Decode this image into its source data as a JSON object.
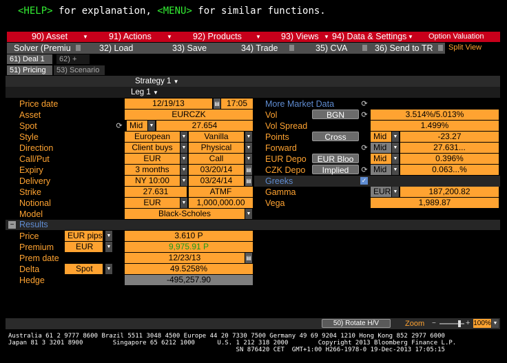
{
  "helpline": {
    "help_key": "<HELP>",
    "help_text": " for explanation, ",
    "menu_key": "<MENU>",
    "menu_text": " for similar functions."
  },
  "menubar": {
    "items": [
      "90) Asset",
      "91) Actions",
      "92) Products",
      "93) Views",
      "94) Data & Settings"
    ],
    "title": "Option Valuation"
  },
  "toolbar": {
    "items": [
      "Solver (Premiu",
      "32) Load",
      "33) Save",
      "34) Trade",
      "35) CVA",
      "36) Send to TR"
    ],
    "split_view": "Split View"
  },
  "tabs": {
    "deal": "61) Deal 1",
    "add": "62) +",
    "pricing": "51) Pricing",
    "scenario": "53) Scenario"
  },
  "header": {
    "strategy": "Strategy 1",
    "leg": "Leg 1"
  },
  "left": {
    "price_date": {
      "label": "Price date",
      "date": "12/19/13",
      "time": "17:05"
    },
    "asset": {
      "label": "Asset",
      "value": "EURCZK"
    },
    "spot": {
      "label": "Spot",
      "side": "Mid",
      "value": "27.654"
    },
    "style": {
      "label": "Style",
      "v1": "European",
      "v2": "Vanilla"
    },
    "direction": {
      "label": "Direction",
      "v1": "Client buys",
      "v2": "Physical"
    },
    "callput": {
      "label": "Call/Put",
      "v1": "EUR",
      "v2": "Call"
    },
    "expiry": {
      "label": "Expiry",
      "v1": "3 months",
      "v2": "03/20/14"
    },
    "delivery": {
      "label": "Delivery",
      "v1": "NY 10:00",
      "v2": "03/24/14"
    },
    "strike": {
      "label": "Strike",
      "v1": "27.631",
      "v2": "ATMF"
    },
    "notional": {
      "label": "Notional",
      "v1": "EUR",
      "v2": "1,000,000.00"
    },
    "model": {
      "label": "Model",
      "value": "Black-Scholes"
    }
  },
  "right": {
    "more_market_data": "More Market Data",
    "vol": {
      "label": "Vol",
      "button": "BGN",
      "value": "3.514%/5.013%"
    },
    "vol_spread": {
      "label": "Vol Spread",
      "value": "1.499%"
    },
    "points": {
      "label": "Points",
      "button": "Cross",
      "side": "Mid",
      "value": "-23.27"
    },
    "forward": {
      "label": "Forward",
      "side": "Mid",
      "value": "27.631..."
    },
    "eur_depo": {
      "label": "EUR Depo",
      "button": "EUR Bloo",
      "side": "Mid",
      "value": "0.396%"
    },
    "czk_depo": {
      "label": "CZK Depo",
      "button": "Implied",
      "side": "Mid",
      "value": "0.063...%"
    },
    "greeks": {
      "label": "Greeks"
    },
    "gamma": {
      "label": "Gamma",
      "ccy": "EUR",
      "value": "187,200.82"
    },
    "vega": {
      "label": "Vega",
      "value": "1,989.87"
    }
  },
  "results": {
    "title": "Results",
    "price": {
      "label": "Price",
      "unit": "EUR pips",
      "value": "3.610 P"
    },
    "premium": {
      "label": "Premium",
      "unit": "EUR",
      "value": "9,975.91 P"
    },
    "prem_date": {
      "label": "Prem date",
      "value": "12/23/13"
    },
    "delta": {
      "label": "Delta",
      "unit": "Spot",
      "value": "49.5258%"
    },
    "hedge": {
      "label": "Hedge",
      "value": "-495,257.90"
    }
  },
  "footer": {
    "rotate": "50) Rotate H/V",
    "zoom_label": "Zoom",
    "zoom_value": "100%"
  },
  "bottom": {
    "line1": "Australia 61 2 9777 8600 Brazil 5511 3048 4500 Europe 44 20 7330 7500 Germany 49 69 9204 1210 Hong Kong 852 2977 6000",
    "line2": "Japan 81 3 3201 8900        Singapore 65 6212 1000      U.S. 1 212 318 2000        Copyright 2013 Bloomberg Finance L.P.",
    "line3": "                                                             SN 876420 CET  GMT+1:00 H266-1978-0 19-Dec-2013 17:05:15"
  },
  "colors": {
    "accent": "#ffa331",
    "menubar": "#c8001b",
    "blue_label": "#5f8cd1",
    "green_key": "#33ee33"
  }
}
